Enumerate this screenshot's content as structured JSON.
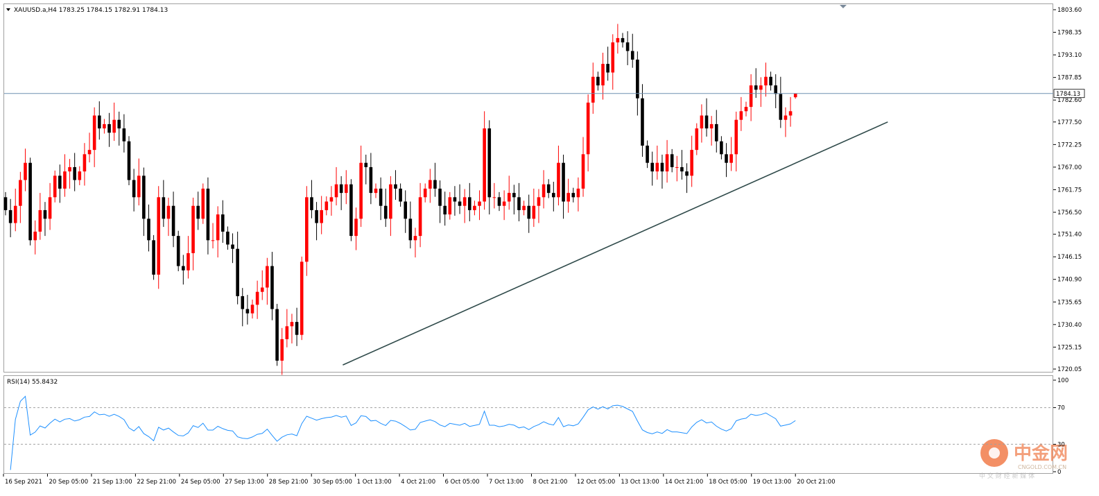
{
  "window": {
    "symbol_line": "XAUUSD.a,H4  1783.25 1784.15 1782.91 1784.13",
    "rsi_line": "RSI(14) 55.8432",
    "current_price_label": "1784.13",
    "watermark_main": "中金网",
    "watermark_url": "CNGOLD.COM.CN",
    "watermark_sub": "中 文 财 经 新 媒 体"
  },
  "colors": {
    "up_candle": "#ff0000",
    "down_candle": "#000000",
    "grid_frame": "#a0a0a0",
    "current_price_line": "#6e8fb0",
    "trendline": "#2f4a4a",
    "rsi_line": "#1e90ff",
    "rsi_levels": "#a0a0a0",
    "watermark": "#e6522a"
  },
  "chart_data": [
    {
      "type": "candlestick",
      "title": "XAUUSD.a,H4",
      "ylim": [
        1720.05,
        1803.6
      ],
      "yticks": [
        "1803.60",
        "1798.35",
        "1793.10",
        "1787.85",
        "1782.60",
        "1777.50",
        "1772.25",
        "1767.00",
        "1761.75",
        "1756.50",
        "1751.40",
        "1746.15",
        "1740.90",
        "1735.65",
        "1730.40",
        "1725.15",
        "1720.05"
      ],
      "x_tick_labels": [
        "16 Sep 2021",
        "20 Sep 05:00",
        "21 Sep 13:00",
        "22 Sep 21:00",
        "24 Sep 05:00",
        "27 Sep 13:00",
        "28 Sep 21:00",
        "30 Sep 05:00",
        "1 Oct 13:00",
        "4 Oct 21:00",
        "6 Oct 05:00",
        "7 Oct 13:00",
        "8 Oct 21:00",
        "12 Oct 05:00",
        "13 Oct 13:00",
        "14 Oct 21:00",
        "18 Oct 05:00",
        "19 Oct 13:00",
        "20 Oct 21:00"
      ],
      "last_bar": {
        "open": 1783.25,
        "high": 1784.15,
        "low": 1782.91,
        "close": 1784.13
      },
      "current_price": 1784.13,
      "trendline": {
        "from": {
          "bar": 70,
          "price": 1721.0
        },
        "to": {
          "bar": 211,
          "price": 1777.5
        }
      },
      "closes": [
        1757,
        1754,
        1758,
        1764,
        1768,
        1750,
        1752,
        1757,
        1755,
        1760,
        1765,
        1762,
        1766,
        1767,
        1764,
        1766,
        1770,
        1771,
        1779,
        1776,
        1777,
        1775,
        1778,
        1776,
        1773,
        1764,
        1760,
        1765,
        1755,
        1750,
        1742,
        1760,
        1755,
        1758,
        1751,
        1744,
        1743,
        1747,
        1758,
        1755,
        1762,
        1750,
        1750,
        1756,
        1752,
        1749,
        1748,
        1737,
        1734,
        1733,
        1735,
        1738,
        1739,
        1744,
        1734,
        1722,
        1727,
        1730,
        1731,
        1728,
        1745,
        1760,
        1757,
        1754,
        1757,
        1759,
        1760,
        1763,
        1761,
        1763,
        1751,
        1755,
        1768,
        1767,
        1761,
        1762,
        1758,
        1755,
        1763,
        1762,
        1759,
        1755,
        1750,
        1751,
        1760,
        1762,
        1764,
        1762,
        1758,
        1756,
        1760,
        1759,
        1758,
        1760,
        1757,
        1758,
        1759,
        1776,
        1760,
        1760,
        1758,
        1759,
        1761,
        1760,
        1757,
        1758,
        1755,
        1758,
        1760,
        1763,
        1761,
        1760,
        1768,
        1759,
        1761,
        1760,
        1762,
        1770,
        1782,
        1788,
        1786,
        1791,
        1789,
        1796,
        1797,
        1796,
        1794,
        1792,
        1783,
        1772,
        1768,
        1766,
        1768,
        1766,
        1770,
        1767,
        1767,
        1766,
        1765,
        1771,
        1776,
        1779,
        1776,
        1777,
        1773,
        1770,
        1768,
        1770,
        1778,
        1780,
        1781,
        1786,
        1785,
        1786,
        1788,
        1786,
        1784,
        1778,
        1779,
        1780,
        1784
      ]
    },
    {
      "type": "line",
      "title": "RSI(14)",
      "ylim": [
        0,
        100
      ],
      "yticks": [
        "100",
        "70",
        "30",
        "0"
      ],
      "levels": [
        70,
        30
      ],
      "last_value": 55.8432
    }
  ]
}
